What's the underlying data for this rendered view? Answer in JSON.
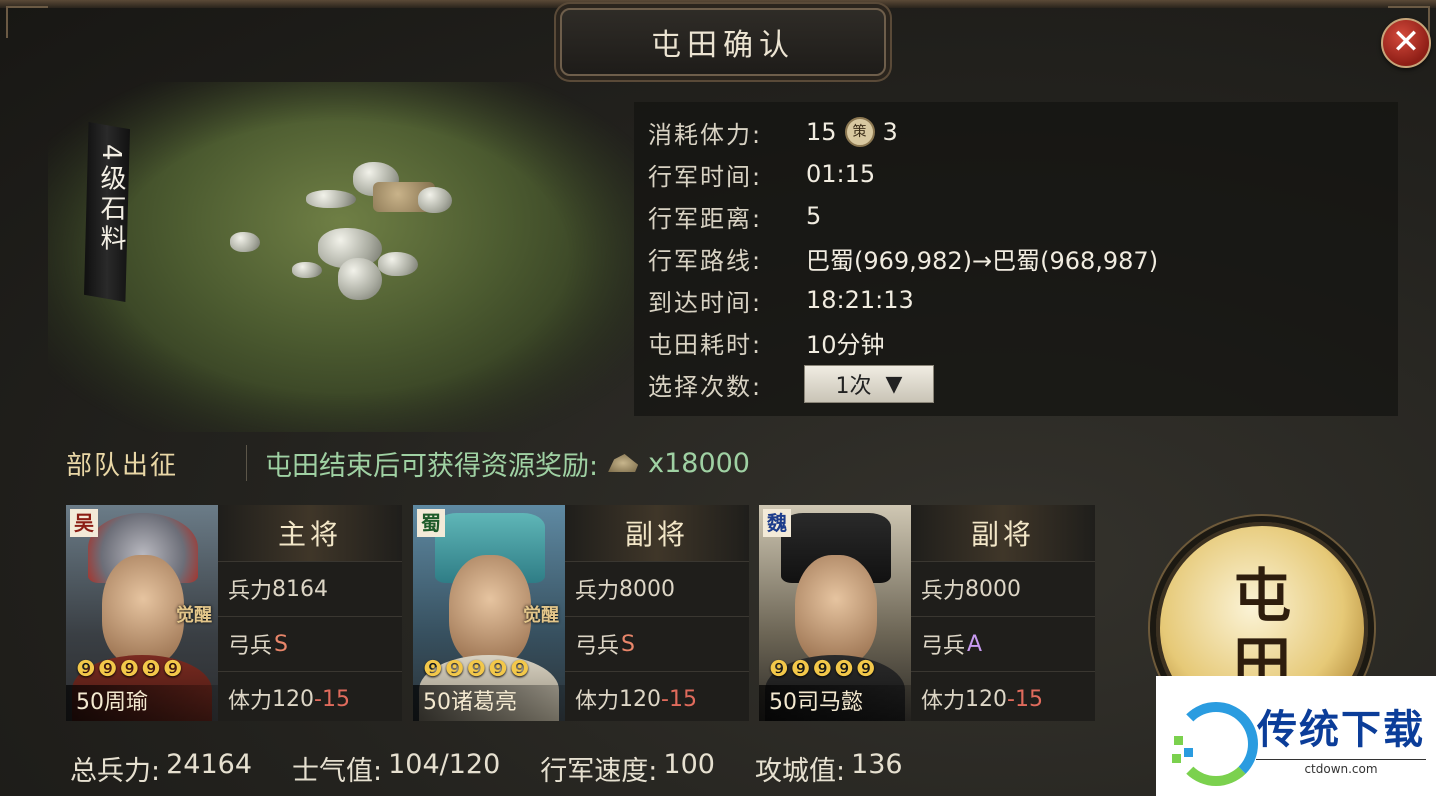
{
  "dialog": {
    "title": "屯田确认",
    "close_symbol": "✕"
  },
  "tile": {
    "level_label": "4级石料"
  },
  "info_rows": [
    {
      "key": "消耗体力:",
      "value": "15",
      "extra_icon": "策",
      "extra_value": "3"
    },
    {
      "key": "行军时间:",
      "value": "01:15"
    },
    {
      "key": "行军距离:",
      "value": "5"
    },
    {
      "key": "行军路线:",
      "value": "巴蜀(969,982)→巴蜀(968,987)"
    },
    {
      "key": "到达时间:",
      "value": "18:21:13"
    },
    {
      "key": "屯田耗时:",
      "value": "10分钟"
    },
    {
      "key": "选择次数:",
      "select_value": "1次",
      "select_arrow": "▼"
    }
  ],
  "march": {
    "label": "部队出征",
    "reward_text": "屯田结束后可获得资源奖励:",
    "reward_amount": "x18000"
  },
  "generals": [
    {
      "faction": "吴",
      "role": "主将",
      "stars": "❾❾❾❾❾",
      "name": "50周瑜",
      "awaken": "觉醒",
      "troops_label": "兵力",
      "troops": "8164",
      "type_label": "弓兵",
      "grade": "S",
      "stamina_label": "体力",
      "stamina": "120",
      "stamina_cost": "-15"
    },
    {
      "faction": "蜀",
      "role": "副将",
      "stars": "❾❾❾❾❾",
      "name": "50诸葛亮",
      "awaken": "觉醒",
      "troops_label": "兵力",
      "troops": "8000",
      "type_label": "弓兵",
      "grade": "S",
      "stamina_label": "体力",
      "stamina": "120",
      "stamina_cost": "-15"
    },
    {
      "faction": "魏",
      "role": "副将",
      "stars": "❾❾❾❾❾",
      "name": "50司马懿",
      "awaken": "",
      "troops_label": "兵力",
      "troops": "8000",
      "type_label": "弓兵",
      "grade": "A",
      "stamina_label": "体力",
      "stamina": "120",
      "stamina_cost": "-15"
    }
  ],
  "action_button": {
    "label": "屯田"
  },
  "totals": {
    "troops_label": "总兵力:",
    "troops": "24164",
    "morale_label": "士气值:",
    "morale": "104/120",
    "speed_label": "行军速度:",
    "speed": "100",
    "siege_label": "攻城值:",
    "siege": "136"
  },
  "watermark": {
    "title": "传统下载",
    "url": "ctdown.com"
  },
  "colors": {
    "reward_green": "#9fd1a3",
    "cost_red": "#e06b5c",
    "grade_s": "#e9866a",
    "grade_a": "#c79af0"
  }
}
